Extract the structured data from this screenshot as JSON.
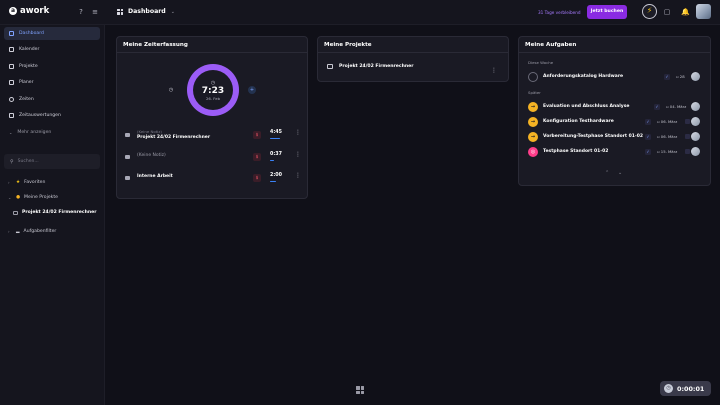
{
  "app": {
    "name": "awork"
  },
  "header": {
    "breadcrumb": "Dashboard",
    "trial_text": "31 Tage verbleibend",
    "buy_label": "Jetzt buchen"
  },
  "sidebar": {
    "items": [
      {
        "label": "Dashboard",
        "icon": "grid-icon"
      },
      {
        "label": "Kalender",
        "icon": "calendar-icon"
      },
      {
        "label": "Projekte",
        "icon": "folder-icon"
      },
      {
        "label": "Planer",
        "icon": "planner-icon"
      },
      {
        "label": "Zeiten",
        "icon": "clock-icon"
      },
      {
        "label": "Zeitauswertungen",
        "icon": "report-icon"
      },
      {
        "label": "Mehr anzeigen",
        "icon": "chevron-down-icon"
      }
    ],
    "search_placeholder": "Suchen...",
    "tree": {
      "favorites": "Favoriten",
      "my_projects": "Meine Projekte",
      "project": "Projekt 24/02 Firmenrechner",
      "task_filter": "Aufgabenfilter"
    }
  },
  "time_card": {
    "title": "Meine Zeiterfassung",
    "total": "7:23",
    "date": "26. Feb",
    "entries": [
      {
        "note": "(Keine Notiz)",
        "name": "Projekt 24/02 Firmenrechner",
        "duration": "4:45"
      },
      {
        "note": "",
        "name": "(Keine Notiz)",
        "duration": "0:37"
      },
      {
        "note": "",
        "name": "Interne Arbeit",
        "duration": "2:00"
      }
    ]
  },
  "projects_card": {
    "title": "Meine Projekte",
    "items": [
      {
        "name": "Projekt 24/02 Firmenrechner"
      }
    ]
  },
  "tasks_card": {
    "title": "Meine Aufgaben",
    "this_week_label": "Diese Woche",
    "later_label": "Später",
    "this_week": [
      {
        "name": "Anforderungskatalog Hardware",
        "due": "28"
      }
    ],
    "later": [
      {
        "name": "Evaluation und Abschluss Analyse",
        "due": "04. März"
      },
      {
        "name": "Konfiguration Testhardware",
        "due": "06. März"
      },
      {
        "name": "Vorbereitung-Testphase Standort 01-02",
        "due": "06. März"
      },
      {
        "name": "Testphase Standort 01-02",
        "due": "15. März"
      }
    ]
  },
  "timer": {
    "value": "0:00:01"
  }
}
